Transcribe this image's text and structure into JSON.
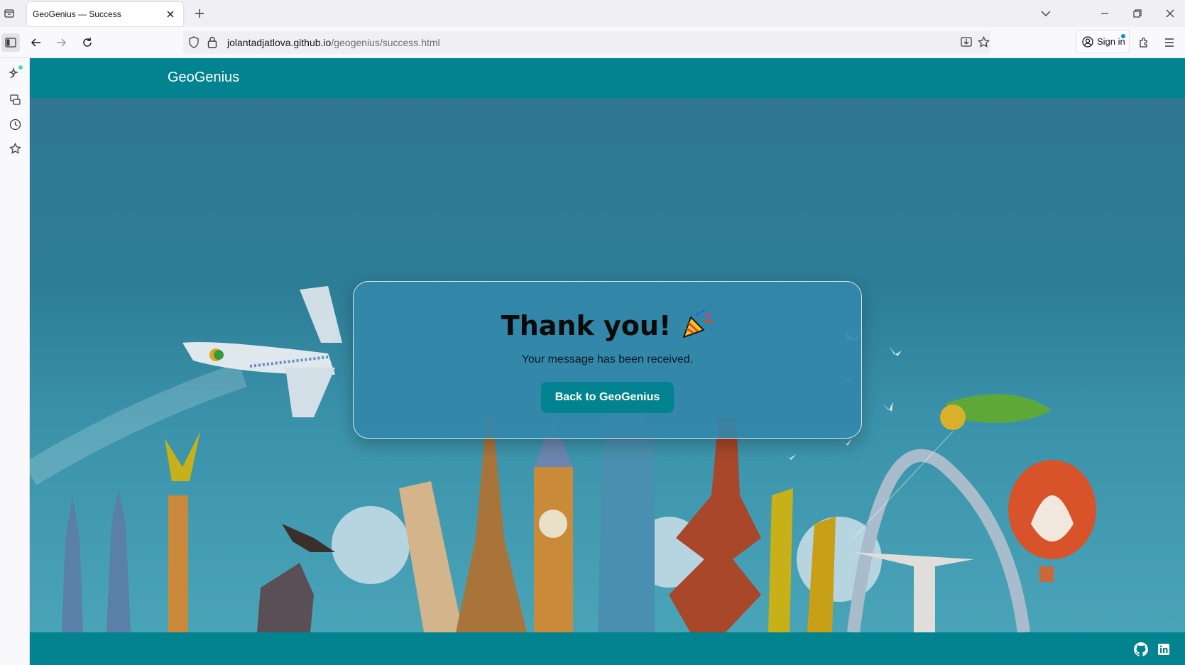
{
  "browser": {
    "tab_title": "GeoGenius — Success",
    "url_domain": "jolantadjatlova.github.io",
    "url_path": "/geogenius/success.html",
    "signin_label": "Sign in"
  },
  "site": {
    "brand": "GeoGenius"
  },
  "card": {
    "title": "Thank you!",
    "message": "Your message has been received.",
    "button_label": "Back to GeoGenius"
  },
  "colors": {
    "header": "#02838f",
    "card": "#3388aa",
    "button": "#02838f"
  },
  "footer": {
    "icons": [
      "github-icon",
      "linkedin-icon"
    ]
  }
}
